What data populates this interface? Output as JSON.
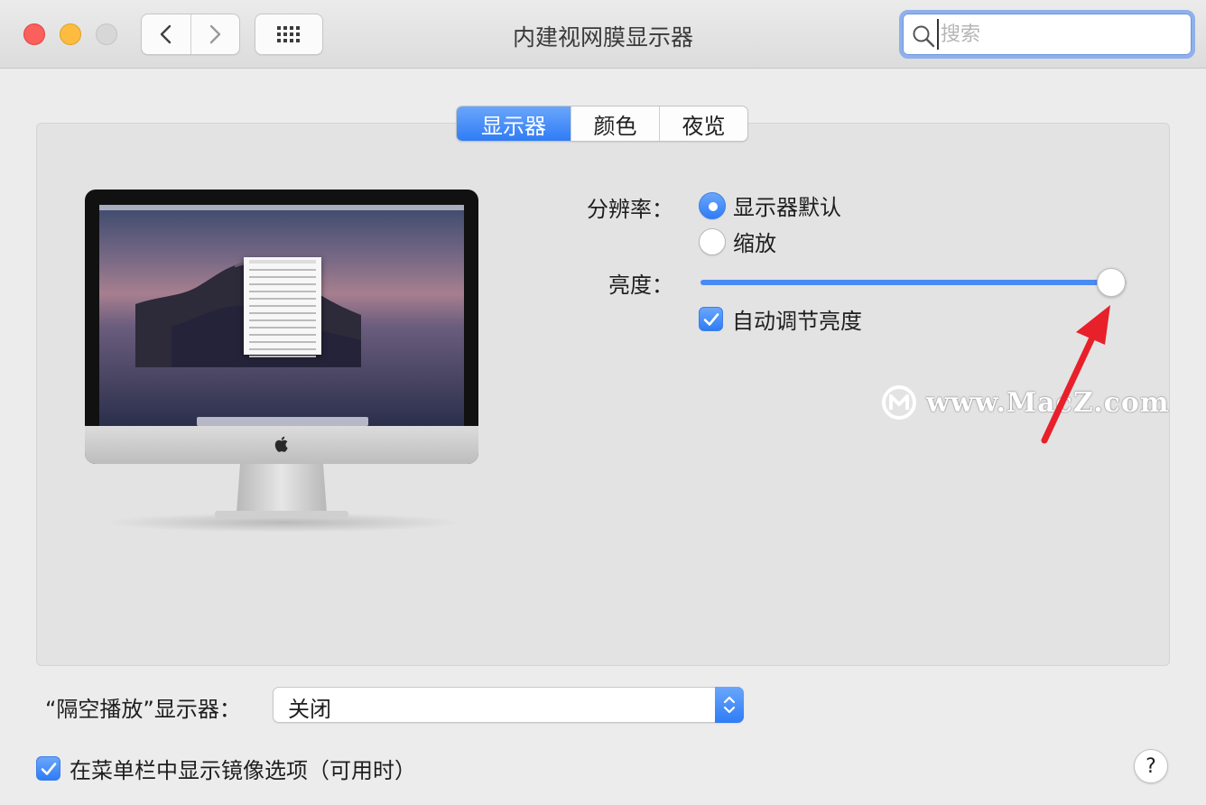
{
  "window": {
    "title": "内建视网膜显示器",
    "search_placeholder": "搜索",
    "search_value": ""
  },
  "tabs": [
    {
      "label": "显示器",
      "selected": true
    },
    {
      "label": "颜色",
      "selected": false
    },
    {
      "label": "夜览",
      "selected": false
    }
  ],
  "display": {
    "resolution_label": "分辨率：",
    "resolution_options": [
      {
        "label": "显示器默认",
        "selected": true
      },
      {
        "label": "缩放",
        "selected": false
      }
    ],
    "brightness_label": "亮度：",
    "brightness_value": 0.97,
    "auto_brightness_label": "自动调节亮度",
    "auto_brightness_checked": true
  },
  "airplay": {
    "label": "“隔空播放”显示器：",
    "selected": "关闭"
  },
  "mirror_option": {
    "label": "在菜单栏中显示镜像选项（可用时）",
    "checked": true
  },
  "help_label": "?",
  "watermark": "www.MacZ.com",
  "colors": {
    "accent": "#2f7cf6",
    "close": "#fc605c",
    "minimize": "#fdbc40",
    "zoom": "#d7d7d7",
    "annotation_arrow": "#e8202a"
  },
  "icons": {
    "back": "chevron-left-icon",
    "forward": "chevron-right-icon",
    "show_all": "grid-icon",
    "search": "magnifier-icon",
    "help": "question-mark-icon"
  }
}
